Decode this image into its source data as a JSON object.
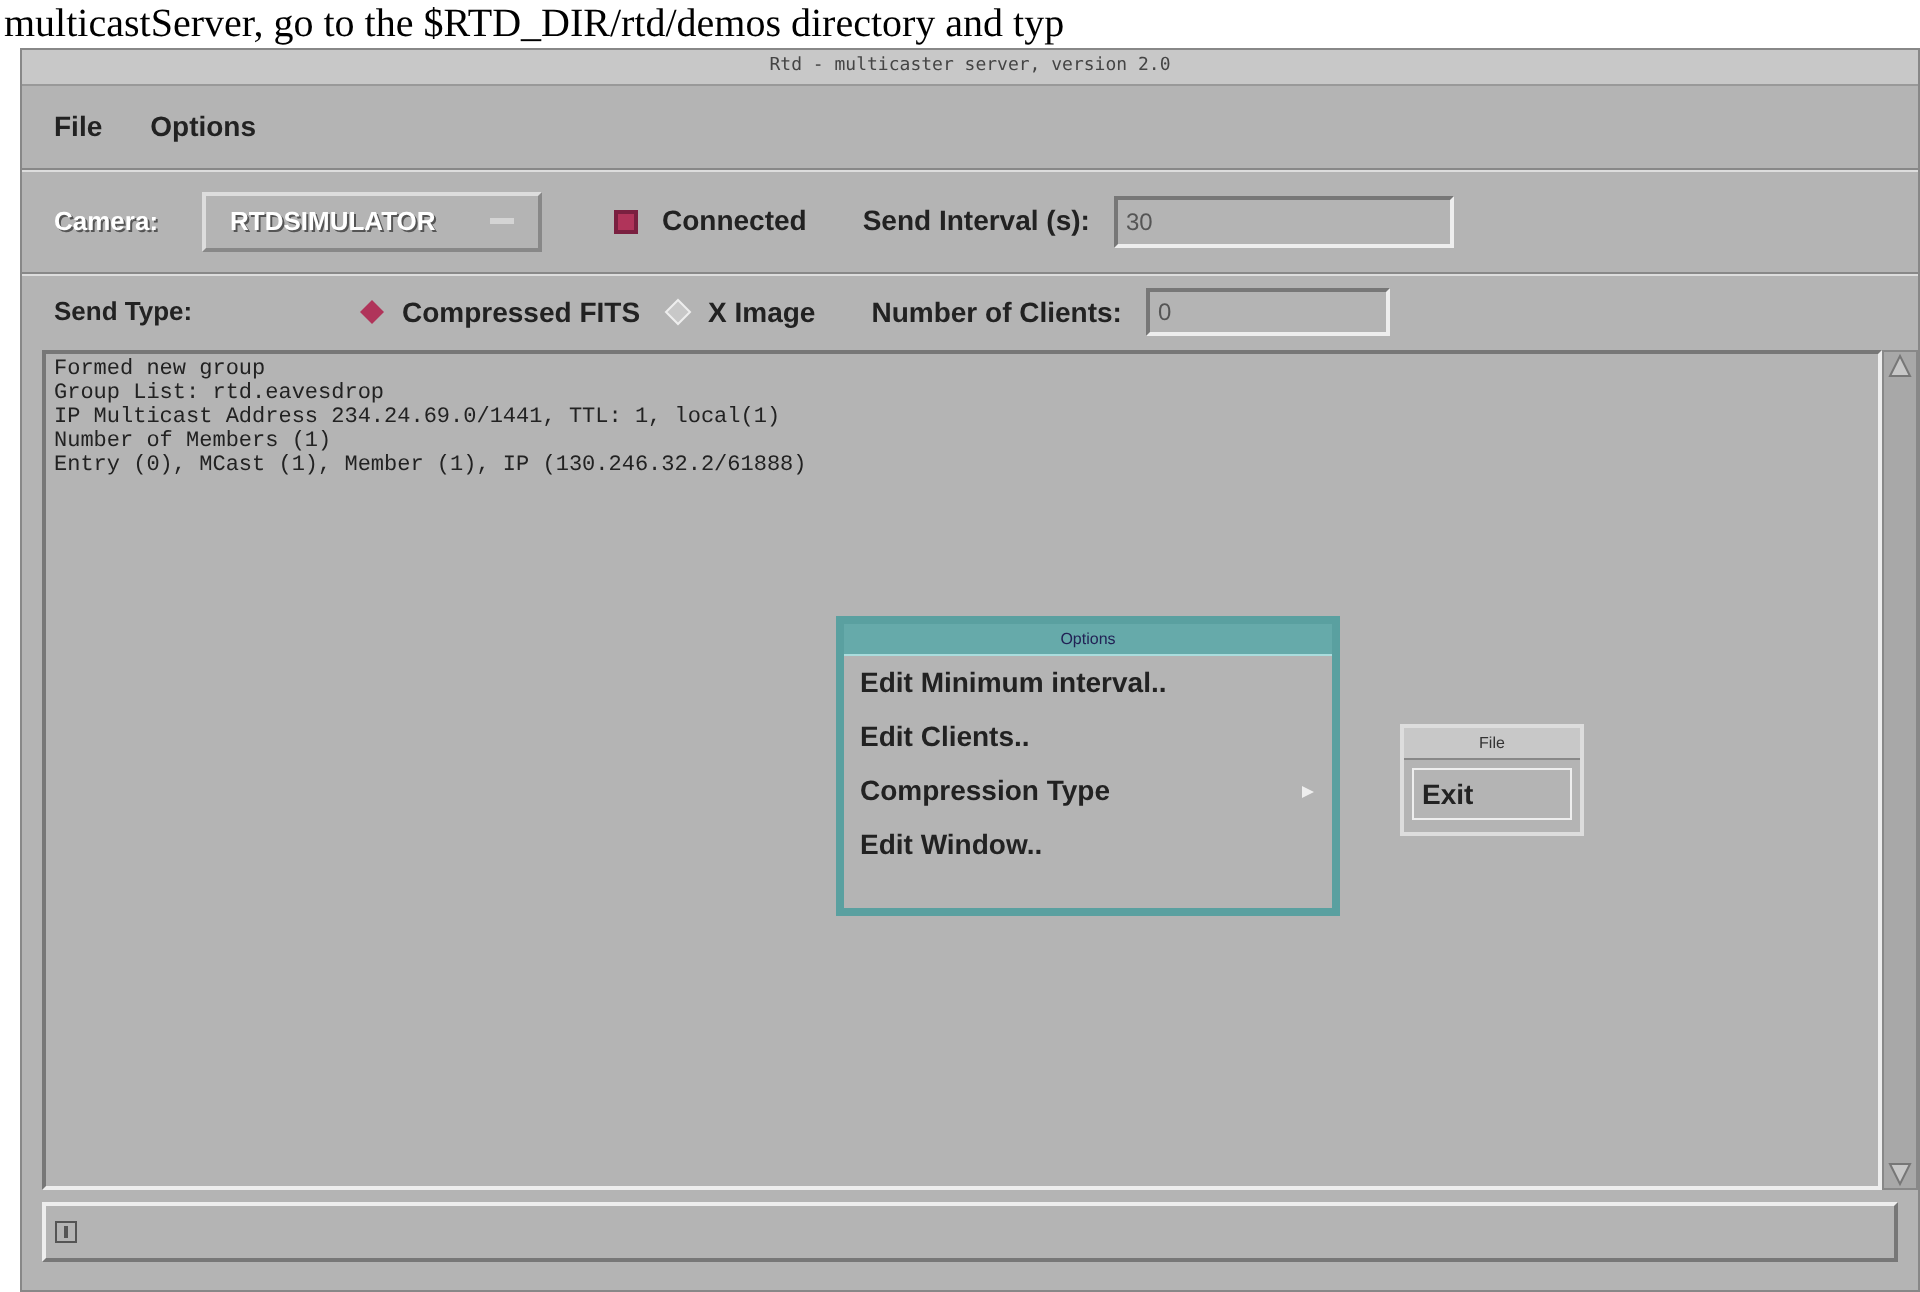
{
  "document_text": "multicastServer, go to the $RTD_DIR/rtd/demos directory and typ",
  "window": {
    "title": "Rtd - multicaster server, version 2.0"
  },
  "menubar": [
    {
      "label": "File"
    },
    {
      "label": "Options"
    }
  ],
  "camera": {
    "label": "Camera:",
    "value": "RTDSIMULATOR",
    "disabled": true
  },
  "connected": {
    "label": "Connected",
    "checked": true
  },
  "send_interval": {
    "label": "Send Interval (s):",
    "value": "30"
  },
  "send_type": {
    "label": "Send Type:",
    "options": [
      {
        "label": "Compressed FITS",
        "selected": true
      },
      {
        "label": "X Image",
        "selected": false
      }
    ]
  },
  "clients": {
    "label": "Number of Clients:",
    "value": "0"
  },
  "log": [
    "Formed new group",
    "Group List: rtd.eavesdrop",
    "IP Multicast Address 234.24.69.0/1441, TTL: 1, local(1)",
    "Number of Members (1)",
    "Entry (0), MCast (1), Member (1), IP (130.246.32.2/61888)"
  ],
  "options_menu": {
    "title": "Options",
    "items": [
      {
        "label": "Edit Minimum interval..",
        "has_submenu": false
      },
      {
        "label": "Edit Clients..",
        "has_submenu": false
      },
      {
        "label": "Compression Type",
        "has_submenu": true
      },
      {
        "label": "Edit Window..",
        "has_submenu": false
      }
    ]
  },
  "file_menu": {
    "title": "File",
    "items": [
      {
        "label": "Exit"
      }
    ]
  }
}
